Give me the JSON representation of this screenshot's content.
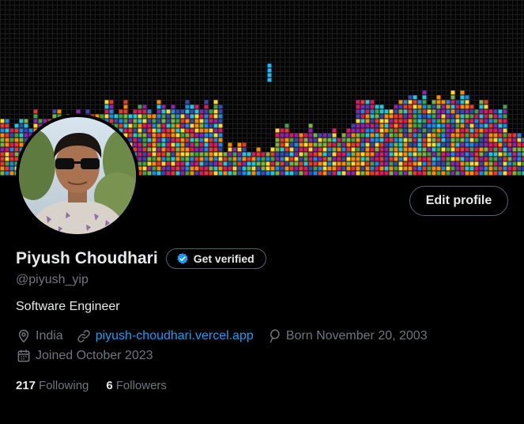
{
  "profile": {
    "name": "Piyush Choudhari",
    "handle": "@piyush_yip",
    "bio": "Software Engineer",
    "get_verified_label": "Get verified",
    "edit_profile_label": "Edit profile"
  },
  "meta": {
    "location": "India",
    "website": "piyush-choudhari.vercel.app",
    "birthday": "Born November 20, 2003",
    "joined": "Joined October 2023"
  },
  "stats": {
    "following_count": "217",
    "following_label": "Following",
    "followers_count": "6",
    "followers_label": "Followers"
  },
  "colors": {
    "accent": "#1d9bf0",
    "muted": "#71767b",
    "text": "#e7e9ea",
    "background": "#000000",
    "border": "#536471"
  },
  "icons": {
    "location": "location-pin-icon",
    "website": "link-icon",
    "birthday": "balloon-icon",
    "joined": "calendar-icon",
    "verified": "verified-badge-icon"
  }
}
